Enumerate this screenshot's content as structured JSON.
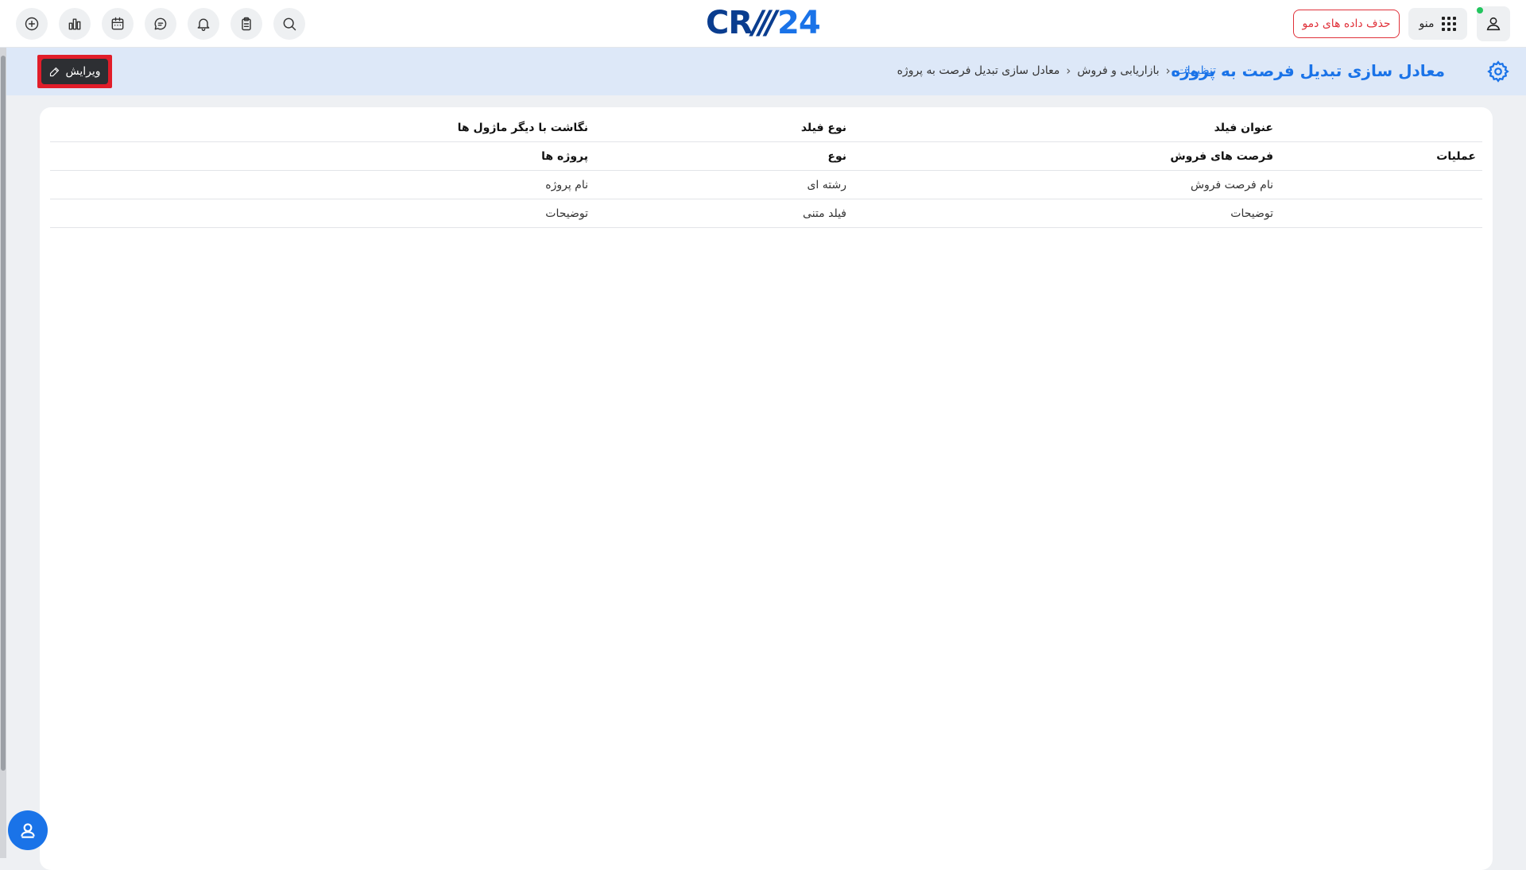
{
  "topbar": {
    "logo": {
      "crm": "CR",
      "slashes": "///",
      "number": "24"
    },
    "demo_button": "حذف داده های دمو",
    "menu_button": "منو",
    "icons": [
      "plus-circle-icon",
      "bar-chart-icon",
      "calendar-icon",
      "chat-icon",
      "bell-icon",
      "clipboard-icon",
      "search-icon"
    ]
  },
  "header": {
    "title": "معادل سازی تبدیل فرصت به پروژه",
    "breadcrumb": [
      "تنظیمات",
      "بازاریابی و فروش",
      "معادل سازی تبدیل فرصت به پروژه"
    ],
    "edit_button": "ویرایش"
  },
  "table": {
    "header": {
      "title": "عنوان فیلد",
      "type": "نوع فیلد",
      "mapping": "نگاشت با دیگر ماژول ها"
    },
    "group_row": {
      "ops": "عملیات",
      "title": "فرصت های فروش",
      "type": "نوع",
      "mapping": "پروژه ها"
    },
    "rows": [
      {
        "title": "نام فرصت فروش",
        "type": "رشته ای",
        "mapping": "نام پروژه"
      },
      {
        "title": "توضیحات",
        "type": "فیلد متنی",
        "mapping": "توضیحات"
      }
    ]
  },
  "colors": {
    "accent": "#1a73e8",
    "danger": "#e0313a",
    "header_band": "#dde8f8",
    "dark_button": "#2d2f33"
  }
}
